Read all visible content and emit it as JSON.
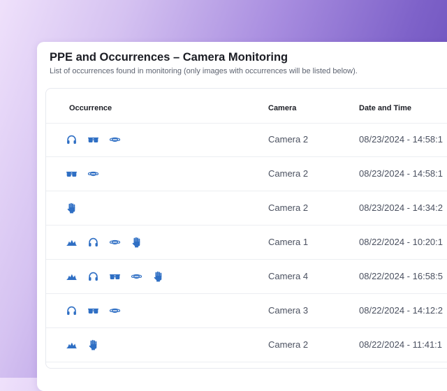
{
  "page": {
    "title": "PPE and Occurrences – Camera Monitoring",
    "subtitle": "List of occurrences found in monitoring (only images with occurrences will be listed below)."
  },
  "table": {
    "headers": [
      "Occurrence",
      "Camera",
      "Date and Time"
    ],
    "rows": [
      {
        "icons": [
          "headphones-icon",
          "goggles-icon",
          "mask-icon"
        ],
        "camera": "Camera 2",
        "datetime": "08/23/2024 - 14:58:1"
      },
      {
        "icons": [
          "goggles-icon",
          "mask-icon"
        ],
        "camera": "Camera 2",
        "datetime": "08/23/2024 - 14:58:1"
      },
      {
        "icons": [
          "glove-icon"
        ],
        "camera": "Camera 2",
        "datetime": "08/23/2024 - 14:34:2"
      },
      {
        "icons": [
          "helmet-icon",
          "headphones-icon",
          "mask-icon",
          "glove-icon"
        ],
        "camera": "Camera 1",
        "datetime": "08/22/2024 - 10:20:1"
      },
      {
        "icons": [
          "helmet-icon",
          "headphones-icon",
          "goggles-icon",
          "mask-icon",
          "glove-icon"
        ],
        "camera": "Camera 4",
        "datetime": "08/22/2024 - 16:58:5"
      },
      {
        "icons": [
          "headphones-icon",
          "goggles-icon",
          "mask-icon"
        ],
        "camera": "Camera 3",
        "datetime": "08/22/2024 - 14:12:2"
      },
      {
        "icons": [
          "helmet-icon",
          "glove-icon"
        ],
        "camera": "Camera 2",
        "datetime": "08/22/2024 - 11:41:1"
      }
    ]
  },
  "colors": {
    "accent_icon": "#2f6fc4",
    "text_dark": "#1b1d24",
    "text_muted": "#4b5160"
  }
}
